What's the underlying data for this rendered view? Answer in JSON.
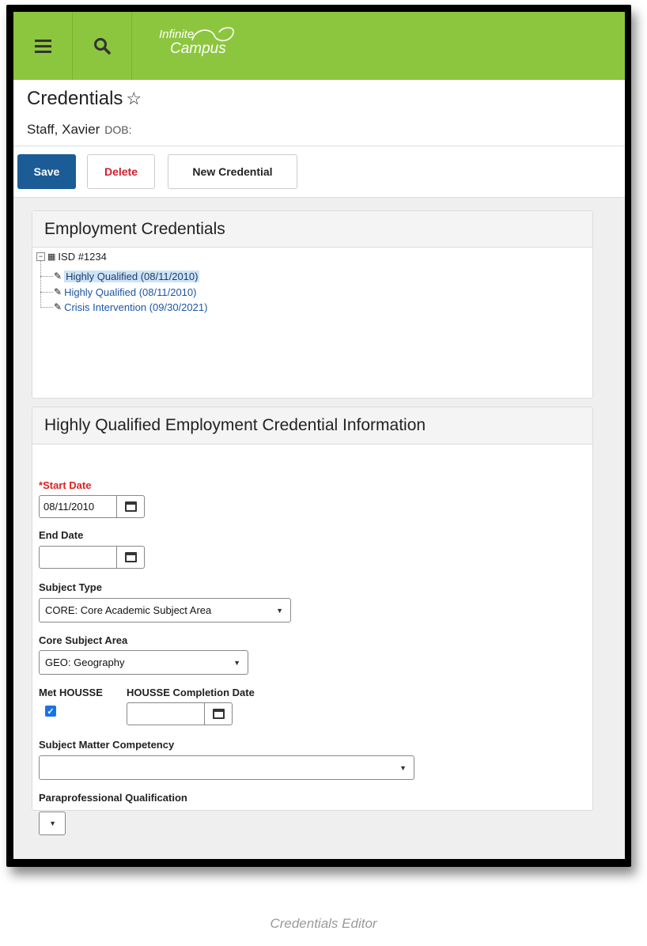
{
  "app": {
    "logo_line1": "Infinite",
    "logo_line2": "Campus",
    "accent": "#8cc63f"
  },
  "header": {
    "title": "Credentials",
    "star": "☆",
    "person_name": "Staff, Xavier",
    "dob_label": "DOB:"
  },
  "actions": {
    "save": "Save",
    "delete": "Delete",
    "new": "New Credential"
  },
  "tree_panel": {
    "title": "Employment Credentials",
    "root": "ISD #1234",
    "items": [
      {
        "label": "Highly Qualified (08/11/2010)",
        "selected": true
      },
      {
        "label": "Highly Qualified (08/11/2010)",
        "selected": false
      },
      {
        "label": "Crisis Intervention (09/30/2021)",
        "selected": false
      }
    ]
  },
  "detail_panel": {
    "title": "Highly Qualified Employment Credential Information",
    "start_date": {
      "label": "Start Date",
      "required_mark": "*",
      "value": "08/11/2010"
    },
    "end_date": {
      "label": "End Date",
      "value": ""
    },
    "subject_type": {
      "label": "Subject Type",
      "value": "CORE: Core Academic Subject Area"
    },
    "core_subject_area": {
      "label": "Core Subject Area",
      "value": "GEO: Geography"
    },
    "met_housse": {
      "label": "Met HOUSSE",
      "checked": true
    },
    "housse_completion_date": {
      "label": "HOUSSE Completion Date",
      "value": ""
    },
    "subject_matter_competency": {
      "label": "Subject Matter Competency",
      "value": ""
    },
    "paraprofessional_qualification": {
      "label": "Paraprofessional Qualification",
      "value": ""
    }
  },
  "caption": "Credentials Editor"
}
